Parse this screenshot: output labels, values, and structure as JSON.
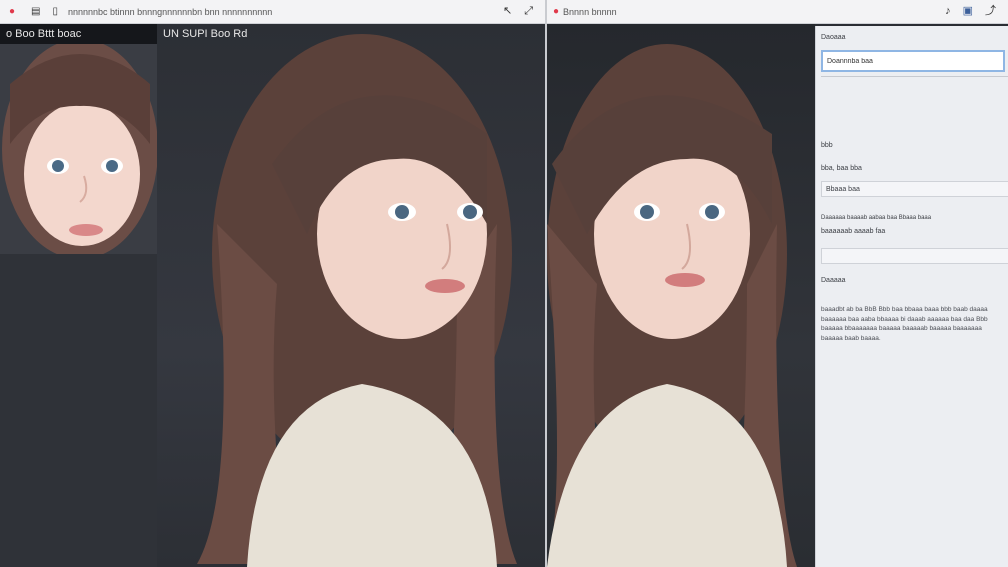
{
  "window_left": {
    "title": "nnnnnnbc btinnn bnnngnnnnnnbn bnn nnnnnnnnnn",
    "icons": [
      "record-icon",
      "grid-icon",
      "phone-icon"
    ],
    "buttons": [
      "back-arrow-icon",
      "expand-icon"
    ]
  },
  "window_right": {
    "title": "Bnnnn bnnnn",
    "icons": [
      "record-icon"
    ],
    "buttons": [
      "music-note-icon",
      "image-icon",
      "share-icon"
    ]
  },
  "thumbnail": {
    "header": "o Boo Bttt boac"
  },
  "main_view": {
    "caption": "UN SUPI Boo Rd"
  },
  "sidebar": {
    "section_title": "Daoaaa",
    "input_value": "Doannnba baa",
    "label_one": "bbb",
    "label_two": "bba, baa bba",
    "field_one": "Bbaaa baa",
    "field_two_line1": "Daaaaaa baaaab aabaa baa Bbaaa baaa",
    "field_two_line2": "baaaaaab aaaab faa",
    "section_two_title": "Daaaaa",
    "paragraph": "baaadbt ab ba BbB Bbb baa bbaaa baaa bbb baab daaaa baaaaaa baa aaba bbaaaa bi daaab aaaaaa baa daa Bbb baaaaa bbaaaaaaa baaaaa baaaaab baaaaa baaaaaaa baaaaa baab baaaa."
  }
}
